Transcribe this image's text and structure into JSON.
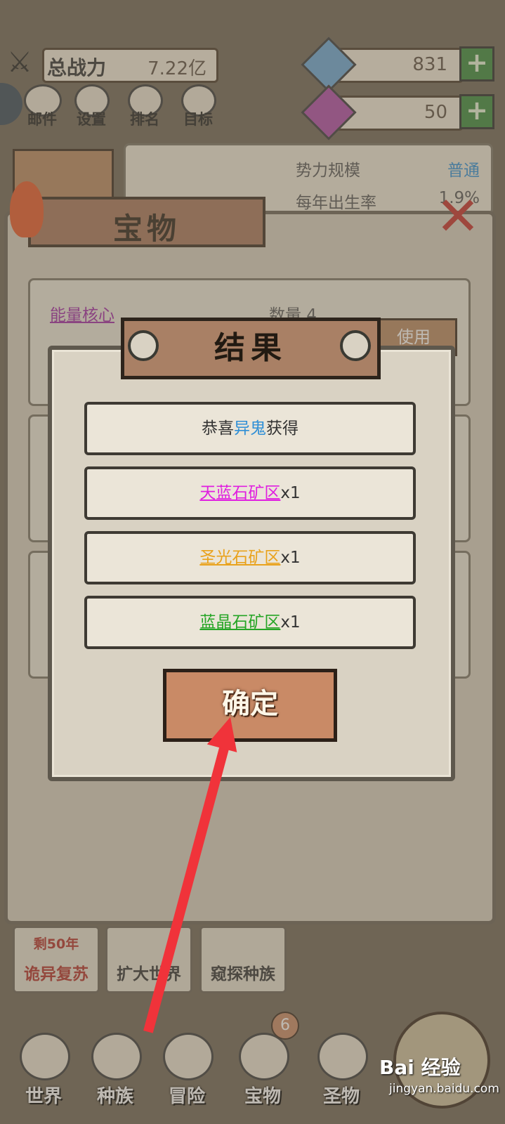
{
  "header": {
    "power_label": "总战力",
    "power_value": "7.22亿",
    "currency1_value": "831",
    "currency2_value": "50"
  },
  "menu": [
    "邮件",
    "设置",
    "排名",
    "目标"
  ],
  "info": {
    "scale_label": "势力规模",
    "scale_value": "普通",
    "birth_label": "每年出生率",
    "birth_value": "1.9%"
  },
  "treasure": {
    "title": "宝物",
    "item_name": "能量核心",
    "item_count_label": "数量 4",
    "use_button": "使用"
  },
  "dialog": {
    "title": "结果",
    "congrats_prefix": "恭喜",
    "congrats_name": "异鬼",
    "congrats_suffix": "获得",
    "rewards": [
      {
        "name": "天蓝石矿区",
        "qty": "x1",
        "color": "#e01fe0"
      },
      {
        "name": "圣光石矿区",
        "qty": "x1",
        "color": "#e9a21c"
      },
      {
        "name": "蓝晶石矿区",
        "qty": "x1",
        "color": "#26a526"
      }
    ],
    "confirm_label": "确定"
  },
  "actions": [
    {
      "label": "诡异复苏",
      "sub": "剩50年"
    },
    {
      "label": "扩大世界"
    },
    {
      "label": "窥探种族"
    }
  ],
  "nav": {
    "items": [
      "世界",
      "种族",
      "冒险",
      "宝物",
      "圣物"
    ],
    "badge": "6"
  },
  "watermark": {
    "brand": "Bai 经验",
    "url": "jingyan.baidu.com"
  },
  "colors": {
    "accent_blue": "#2f8fd6",
    "arrow_red": "#f0333a"
  }
}
